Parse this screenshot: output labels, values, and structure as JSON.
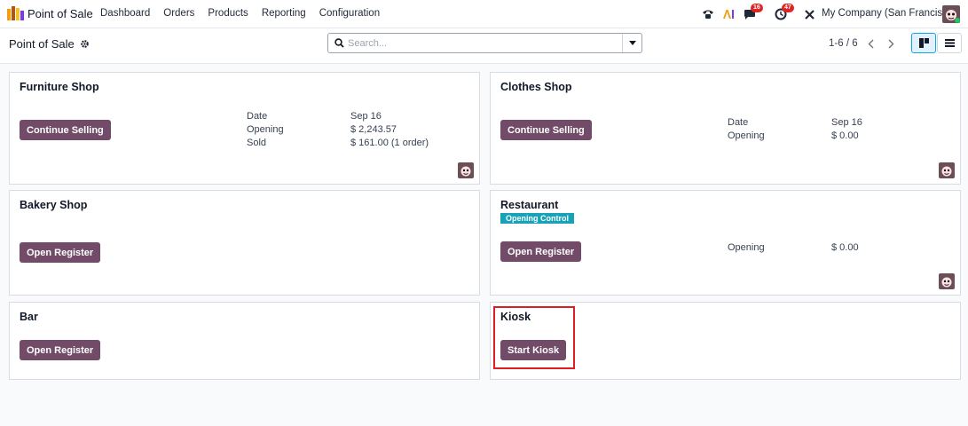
{
  "navbar": {
    "app_title": "Point of Sale",
    "menu": [
      "Dashboard",
      "Orders",
      "Products",
      "Reporting",
      "Configuration"
    ],
    "messages_badge": "16",
    "activities_badge": "47",
    "company": "My Company (San Francisco)"
  },
  "control": {
    "breadcrumb": "Point of Sale",
    "search_placeholder": "Search...",
    "pager": "1-6 / 6"
  },
  "cards": {
    "furniture": {
      "title": "Furniture Shop",
      "button": "Continue Selling",
      "labels": [
        "Date",
        "Opening",
        "Sold"
      ],
      "values": [
        "Sep 16",
        "$ 2,243.57",
        "$ 161.00 (1 order)"
      ]
    },
    "clothes": {
      "title": "Clothes Shop",
      "button": "Continue Selling",
      "labels": [
        "Date",
        "Opening"
      ],
      "values": [
        "Sep 16",
        "$ 0.00"
      ]
    },
    "bakery": {
      "title": "Bakery Shop",
      "button": "Open Register"
    },
    "restaurant": {
      "title": "Restaurant",
      "tag": "Opening Control",
      "button": "Open Register",
      "labels": [
        "Opening"
      ],
      "values": [
        "$ 0.00"
      ]
    },
    "bar": {
      "title": "Bar",
      "button": "Open Register"
    },
    "kiosk": {
      "title": "Kiosk",
      "button": "Start Kiosk"
    }
  },
  "colors": {
    "primary": "#714b67",
    "tag": "#17a2b8",
    "badge": "#dc2626",
    "highlight": "#e11d24",
    "active_view": "#0ea5e9"
  },
  "icons": [
    "pos-app-icon",
    "phone-icon",
    "ai-icon",
    "chat-icon",
    "clock-icon",
    "tools-icon",
    "gear-icon",
    "search-icon",
    "caret-down-icon",
    "chevron-left-icon",
    "chevron-right-icon",
    "kanban-view-icon",
    "list-view-icon",
    "user-avatar-icon"
  ]
}
